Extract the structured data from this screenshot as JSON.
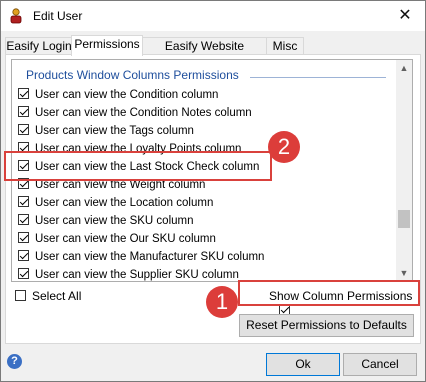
{
  "window": {
    "title": "Edit User",
    "close_label": "✕"
  },
  "tabs": [
    {
      "label": "Easify Login"
    },
    {
      "label": "Permissions"
    },
    {
      "label": "Easify Website Account"
    },
    {
      "label": "Misc"
    }
  ],
  "list": {
    "group_header": "Products Window Columns Permissions",
    "items": [
      {
        "label": "User can view the Condition column",
        "checked": true
      },
      {
        "label": "User can view the Condition Notes column",
        "checked": true
      },
      {
        "label": "User can view the Tags column",
        "checked": true
      },
      {
        "label": "User can view the Loyalty Points column",
        "checked": true
      },
      {
        "label": "User can view the Last Stock Check column",
        "checked": true
      },
      {
        "label": "User can view the Weight column",
        "checked": true
      },
      {
        "label": "User can view the Location column",
        "checked": true
      },
      {
        "label": "User can view the SKU column",
        "checked": true
      },
      {
        "label": "User can view the Our SKU column",
        "checked": true
      },
      {
        "label": "User can view the Manufacturer SKU column",
        "checked": true
      },
      {
        "label": "User can view the Supplier SKU column",
        "checked": true
      }
    ]
  },
  "controls": {
    "select_all_label": "Select All",
    "select_all_checked": false,
    "show_column_permissions_label": "Show Column Permissions",
    "show_column_permissions_checked": true,
    "reset_label": "Reset Permissions to Defaults"
  },
  "footer": {
    "help": "?",
    "ok_label": "Ok",
    "cancel_label": "Cancel"
  },
  "annotations": {
    "badge_1": "1",
    "badge_2": "2",
    "highlight_color": "#d9413c"
  }
}
